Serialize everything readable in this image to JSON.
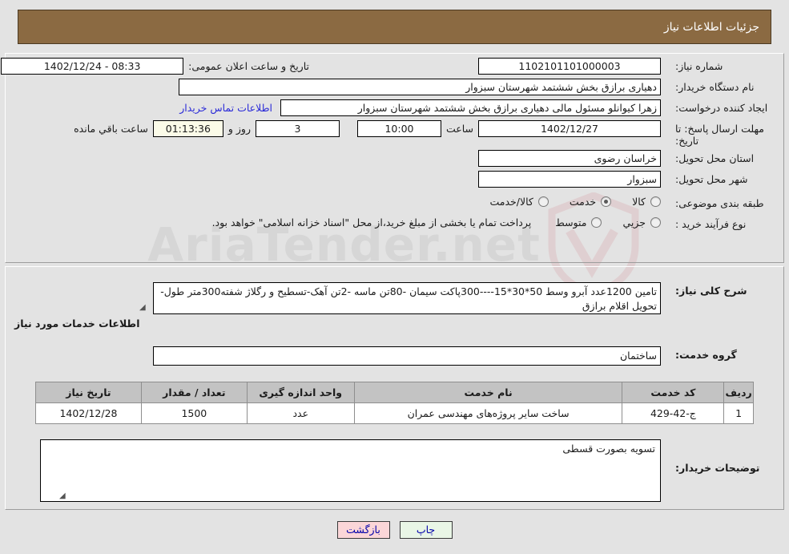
{
  "header": {
    "title": "جزئیات اطلاعات نیاز"
  },
  "form": {
    "need_number_label": "شماره نیاز:",
    "need_number_value": "1102101101000003",
    "public_announce_label": "تاریخ و ساعت اعلان عمومی:",
    "public_announce_value": "08:33 - 1402/12/24",
    "buyer_org_label": "نام دستگاه خریدار:",
    "buyer_org_value": "دهیاری برازق بخش ششتمد شهرستان سبزوار",
    "creator_label": "ایجاد کننده درخواست:",
    "creator_value": "زهرا کیوانلو مسئول مالی دهیاری برازق بخش ششتمد شهرستان سبزوار",
    "contact_link": "اطلاعات تماس خریدار",
    "deadline_label": "مهلت ارسال پاسخ: تا تاریخ:",
    "deadline_date": "1402/12/27",
    "hour_word": "ساعت",
    "deadline_time": "10:00",
    "days_value": "3",
    "days_word": "روز و",
    "countdown_value": "01:13:36",
    "remaining_word": "ساعت باقي مانده",
    "province_label": "استان محل تحویل:",
    "province_value": "خراسان رضوی",
    "city_label": "شهر محل تحویل:",
    "city_value": "سبزوار",
    "category_label": "طبقه بندی موضوعی:",
    "category_options": [
      {
        "label": "کالا",
        "selected": false
      },
      {
        "label": "خدمت",
        "selected": true
      },
      {
        "label": "کالا/خدمت",
        "selected": false
      }
    ],
    "process_label": "نوع فرآیند خرید :",
    "process_options": [
      {
        "label": "جزیي",
        "selected": false
      },
      {
        "label": "متوسط",
        "selected": false
      }
    ],
    "process_note": "پرداخت تمام یا بخشی از مبلغ خرید،از محل \"اسناد خزانه اسلامی\" خواهد بود."
  },
  "description": {
    "label": "شرح کلی نیاز:",
    "value": "تامین 1200عدد آبرو وسط 50*30*15----300پاکت سیمان -80تن ماسه -2تن آهک-تسطیح و رگلاژ شفته300متر طول-تحویل اقلام برازق"
  },
  "services": {
    "section_title": "اطلاعات خدمات مورد نیاز",
    "group_label": "گروه خدمت:",
    "group_value": "ساختمان",
    "columns": [
      "ردیف",
      "کد خدمت",
      "نام خدمت",
      "واحد اندازه گیری",
      "تعداد / مقدار",
      "تاریخ نیاز"
    ],
    "rows": [
      {
        "radif": "1",
        "code": "ج-42-429",
        "name": "ساخت سایر پروژه‌های مهندسی عمران",
        "unit": "عدد",
        "qty": "1500",
        "date": "1402/12/28"
      }
    ]
  },
  "notes": {
    "label": "توضیحات خریدار:",
    "value": "تسویه بصورت قسطی"
  },
  "buttons": {
    "print": "چاپ",
    "back": "بازگشت"
  },
  "colors": {
    "header_bg": "#8b6a42",
    "link": "#2b2bd8",
    "print_btn": "#e9f6e6",
    "back_btn": "#fbd6d8",
    "highlight_field": "#fbfbe8"
  }
}
